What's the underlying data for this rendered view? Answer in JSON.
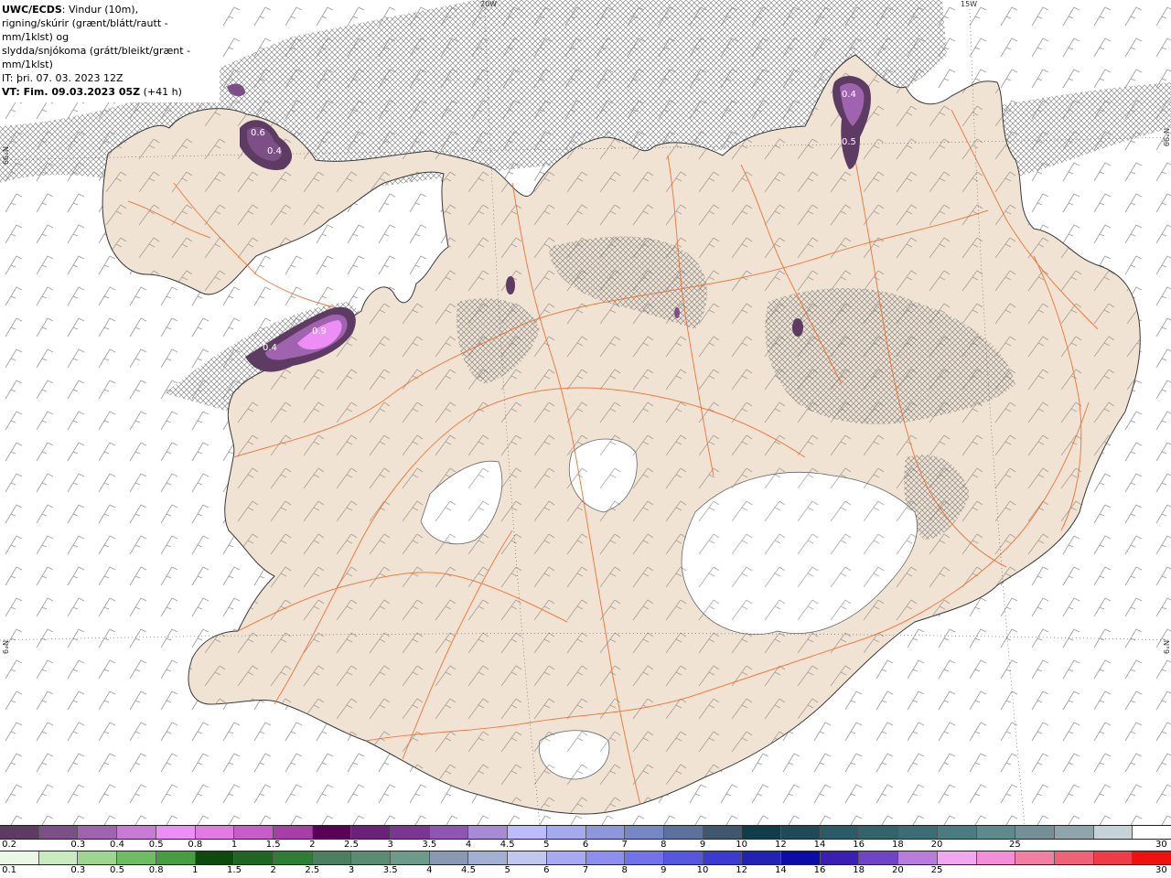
{
  "header": {
    "line1_bold": "UWC/ECDS",
    "line1_rest": ": Vindur (10m),",
    "line2": "rigning/skúrir (grænt/blátt/rautt - mm/1klst) og",
    "line3": "slydda/snjókoma (grátt/bleikt/grænt - mm/1klst)",
    "it_line": "IT: þri. 07. 03. 2023 12Z",
    "vt_bold": "VT: Fim. 09.03.2023 05Z",
    "vt_rest": " (+41 h)"
  },
  "grid_labels": {
    "lon_20w": "20W",
    "lon_15w": "15W",
    "lat_left_top": "N°99",
    "lat_right_top": "N°99",
    "lat_left_bottom": "N°9",
    "lat_right_bottom": "N°9"
  },
  "precip_labels": [
    {
      "id": "nw-1",
      "text": "0.6"
    },
    {
      "id": "nw-2",
      "text": "0.4"
    },
    {
      "id": "w-1",
      "text": "0.9"
    },
    {
      "id": "w-2",
      "text": "0.4"
    },
    {
      "id": "ne-1",
      "text": "0.4"
    },
    {
      "id": "ne-2",
      "text": "0.5"
    }
  ],
  "legend_snow": {
    "colors": [
      "#5e3b63",
      "#7d4f87",
      "#a063b0",
      "#c97ad6",
      "#ec8ef5",
      "#e379e3",
      "#c85cc8",
      "#a83fa8",
      "#5a0058",
      "#6b2177",
      "#7a3691",
      "#8f55b3",
      "#a98ad6",
      "#babcff",
      "#a3aaf0",
      "#8d98dc",
      "#7786c4",
      "#5d719e",
      "#40576f",
      "#0f3d4a",
      "#1f4b58",
      "#2a5b66",
      "#33646b",
      "#3a6e74",
      "#497c80",
      "#5d8a8c",
      "#738f97",
      "#90a4ab",
      "#c5d3d6",
      "#ffffff"
    ],
    "ticks": [
      "0.2",
      "0.3",
      "0.4",
      "0.5",
      "0.8",
      "1",
      "1.5",
      "2",
      "2.5",
      "3",
      "3.5",
      "4",
      "4.5",
      "5",
      "6",
      "7",
      "8",
      "9",
      "10",
      "12",
      "14",
      "16",
      "18",
      "20",
      "25",
      "30"
    ]
  },
  "legend_rain": {
    "colors": [
      "#e9f7e4",
      "#c8ecbf",
      "#9ed590",
      "#6ebd63",
      "#479e41",
      "#0e4a0e",
      "#1f6622",
      "#2f7e36",
      "#4b7f5e",
      "#5a8c74",
      "#6e9a8c",
      "#8a99b3",
      "#a3b0d4",
      "#c2c7ef",
      "#a7a9f2",
      "#8e8ef0",
      "#7273ea",
      "#5557e0",
      "#3c3bd0",
      "#2222b5",
      "#0c0ca8",
      "#3b1fb2",
      "#6f44c6",
      "#b77cdc",
      "#f0a7f0",
      "#f58ed8",
      "#f27ea3",
      "#f06277",
      "#ef3c49",
      "#ef1010"
    ],
    "ticks": [
      "0.1",
      "0.3",
      "0.5",
      "0.8",
      "1",
      "1.5",
      "2",
      "2.5",
      "3",
      "3.5",
      "4",
      "4.5",
      "5",
      "6",
      "7",
      "8",
      "9",
      "10",
      "12",
      "14",
      "16",
      "18",
      "20",
      "25",
      "30"
    ]
  }
}
